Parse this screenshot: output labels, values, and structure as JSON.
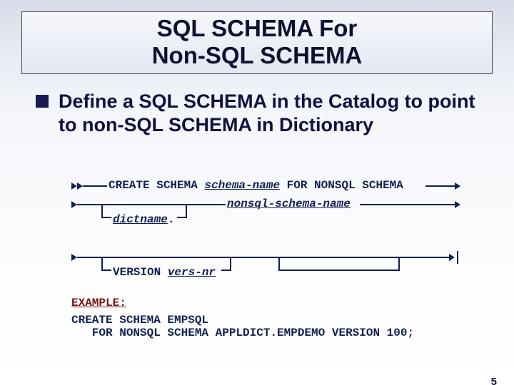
{
  "title": {
    "line1": "SQL SCHEMA For",
    "line2": "Non-SQL SCHEMA"
  },
  "bullet": {
    "text": "Define a SQL SCHEMA in the Catalog to point to non-SQL SCHEMA in Dictionary"
  },
  "syntax": {
    "kw_create_schema": "CREATE SCHEMA ",
    "ph_schema_name": "schema-name",
    "kw_for_nonsql": " FOR NONSQL SCHEMA",
    "ph_nonsql_schema_name": "nonsql-schema-name",
    "ph_dictname": "dictname",
    "dot": ".",
    "kw_version": "VERSION ",
    "ph_vers_nr": "vers-nr"
  },
  "example": {
    "label": "EXAMPLE:",
    "line1": "CREATE SCHEMA EMPSQL",
    "line2": "   FOR NONSQL SCHEMA APPLDICT.EMPDEMO VERSION 100;"
  },
  "page_number": "5"
}
